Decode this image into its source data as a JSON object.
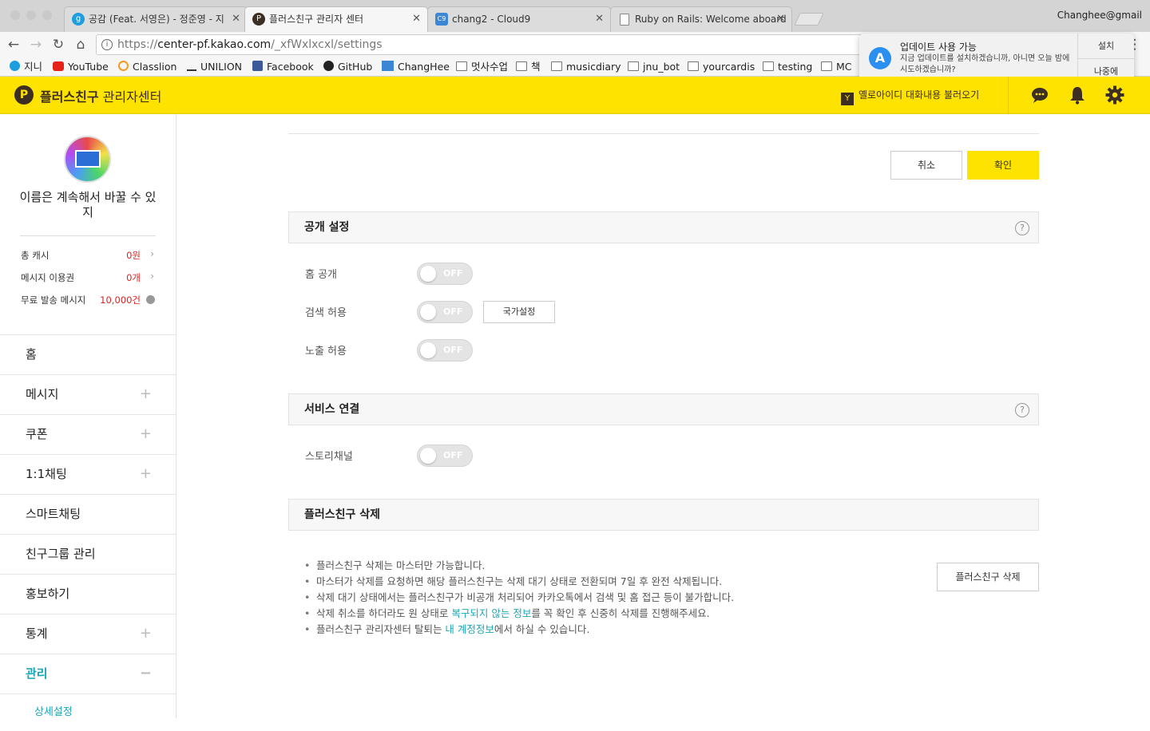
{
  "browser": {
    "tabs": [
      {
        "title": "공감 (Feat. 서영은) - 정준영 - 지",
        "favicon": "g",
        "favicon_color": "#1e9ede"
      },
      {
        "title": "플러스친구 관리자 센터",
        "favicon": "P",
        "favicon_color": "#3d2e23"
      },
      {
        "title": "chang2 - Cloud9",
        "favicon": "C9",
        "favicon_color": "#3c86d6"
      },
      {
        "title": "Ruby on Rails: Welcome aboard",
        "favicon": "doc",
        "favicon_color": "#ffffff"
      }
    ],
    "profile": "Changhee@gmail",
    "url_host": "center-pf.kakao.com",
    "url_scheme": "https://",
    "url_path": "/_xfWxlxcxl/settings",
    "bookmarks": [
      "지니",
      "YouTube",
      "Classlion",
      "UNILION",
      "Facebook",
      "GitHub",
      "ChangHee",
      "멋사수업",
      "책",
      "musicdiary",
      "jnu_bot",
      "yourcardis",
      "testing",
      "MC"
    ]
  },
  "notification": {
    "title": "업데이트 사용 가능",
    "body": "지금 업데이트를 설치하겠습니까, 아니면 오늘 밤에 시도하겠습니까?",
    "install": "설치",
    "later": "나중에"
  },
  "header": {
    "brand_bold": "플러스친구",
    "brand_sub": " 관리자센터",
    "yellowid_label": "옐로아이디 대화내용 불러오기",
    "yellowid_badge": "Y"
  },
  "sidebar": {
    "profile_name": "이름은 계속해서 바꿀 수 있지",
    "stats": [
      {
        "label": "총 캐시",
        "value": "0원"
      },
      {
        "label": "메시지 이용권",
        "value": "0개"
      },
      {
        "label": "무료 발송 메시지",
        "value": "10,000건"
      }
    ],
    "menu": [
      {
        "label": "홈",
        "expand": ""
      },
      {
        "label": "메시지",
        "expand": "+"
      },
      {
        "label": "쿠폰",
        "expand": "+"
      },
      {
        "label": "1:1채팅",
        "expand": "+"
      },
      {
        "label": "스마트채팅",
        "expand": ""
      },
      {
        "label": "친구그룹 관리",
        "expand": ""
      },
      {
        "label": "홍보하기",
        "expand": ""
      },
      {
        "label": "통계",
        "expand": "+"
      },
      {
        "label": "관리",
        "expand": "−"
      }
    ],
    "submenu_active": "상세설정"
  },
  "main": {
    "cancel": "취소",
    "confirm": "확인",
    "public_section": {
      "title": "공개 설정",
      "rows": [
        {
          "label": "홈 공개",
          "state": "OFF"
        },
        {
          "label": "검색 허용",
          "state": "OFF"
        },
        {
          "label": "노출 허용",
          "state": "OFF"
        }
      ],
      "country_button": "국가설정"
    },
    "service_section": {
      "title": "서비스 연결",
      "rows": [
        {
          "label": "스토리채널",
          "state": "OFF"
        }
      ]
    },
    "delete_section": {
      "title": "플러스친구 삭제",
      "button": "플러스친구 삭제",
      "notes": [
        {
          "pre": "플러스친구 삭제는 마스터만 가능합니다.",
          "link": "",
          "post": ""
        },
        {
          "pre": "마스터가 삭제를 요청하면 해당 플러스친구는 삭제 대기 상태로 전환되며 7일 후 완전 삭제됩니다.",
          "link": "",
          "post": ""
        },
        {
          "pre": "삭제 대기 상태에서는 플러스친구가 비공개 처리되어 카카오톡에서 검색 및 홈 접근 등이 불가합니다.",
          "link": "",
          "post": ""
        },
        {
          "pre": "삭제 취소를 하더라도 원 상태로 ",
          "link": "복구되지 않는 정보",
          "post": "를 꼭 확인 후 신중히 삭제를 진행해주세요."
        },
        {
          "pre": "플러스친구 관리자센터 탈퇴는 ",
          "link": "내 계정정보",
          "post": "에서 하실 수 있습니다."
        }
      ]
    },
    "help_glyph": "?"
  },
  "colors": {
    "brand_yellow": "#ffe300",
    "brand_brown": "#3d2e23",
    "accent_teal": "#1aa5b8",
    "alert_red": "#e02020"
  }
}
